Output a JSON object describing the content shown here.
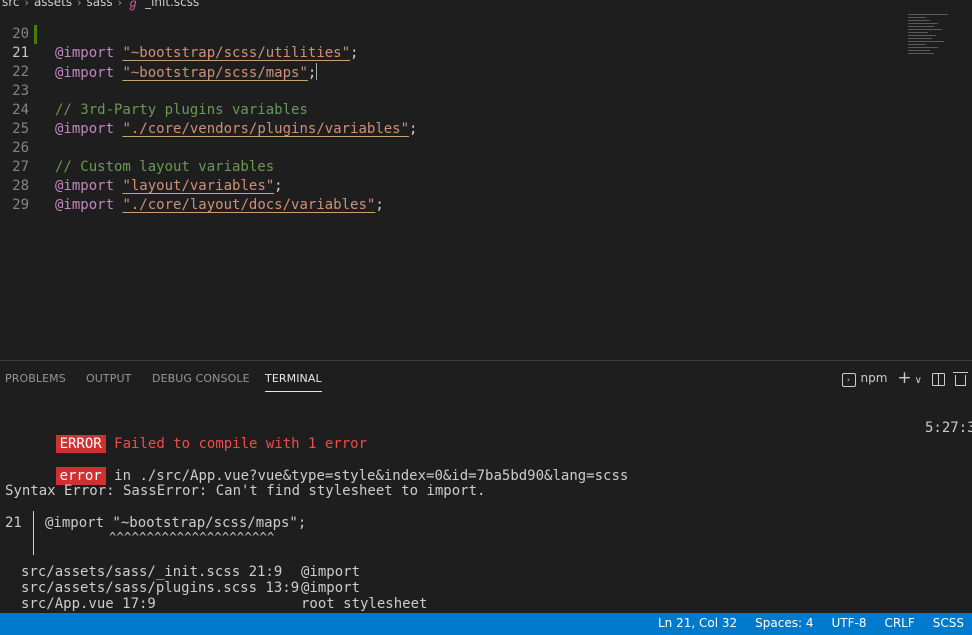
{
  "breadcrumb": [
    "src",
    "assets",
    "sass",
    "_init.scss"
  ],
  "editor": {
    "lines": [
      {
        "n": "20",
        "kw": "@import",
        "str": "\"~bootstrap/scss/utilities\"",
        "end": ";"
      },
      {
        "n": "21",
        "kw": "@import",
        "str": "\"~bootstrap/scss/maps\"",
        "end": ";"
      },
      {
        "n": "22"
      },
      {
        "n": "23",
        "comment": "// 3rd-Party plugins variables"
      },
      {
        "n": "24",
        "kw": "@import",
        "str": "\"./core/vendors/plugins/variables\"",
        "end": ";"
      },
      {
        "n": "25"
      },
      {
        "n": "26",
        "comment": "// Custom layout variables"
      },
      {
        "n": "27",
        "kw": "@import",
        "str": "\"layout/variables\"",
        "end": ";"
      },
      {
        "n": "28",
        "kw": "@import",
        "str": "\"./core/layout/docs/variables\"",
        "end": ";"
      },
      {
        "n": "29"
      }
    ]
  },
  "panel": {
    "tabs": [
      "PROBLEMS",
      "OUTPUT",
      "DEBUG CONSOLE",
      "TERMINAL"
    ],
    "terminal_name": "npm",
    "add_symbol": "+",
    "dropdown_symbol": "∨"
  },
  "terminal": {
    "error_badge": "ERROR",
    "error_msg": "Failed to compile with 1 error",
    "time": "5:27:3",
    "err_badge": "error",
    "err_location": " in ./src/App.vue?vue&type=style&index=0&id=7ba5bd90&lang=scss",
    "syntax_error": "Syntax Error: SassError: Can't find stylesheet to import.",
    "code_line_no": "21",
    "code_line": "@import \"~bootstrap/scss/maps\";",
    "carets": "^^^^^^^^^^^^^^^^^^^^^^",
    "stack": [
      {
        "file": "src/assets/sass/_init.scss 21:9",
        "what": "@import"
      },
      {
        "file": "src/assets/sass/plugins.scss 13:9",
        "what": "@import"
      },
      {
        "file": "src/App.vue 17:9",
        "what": "root stylesheet"
      }
    ]
  },
  "statusbar": {
    "position": "Ln 21, Col 32",
    "spaces": "Spaces: 4",
    "encoding": "UTF-8",
    "eol": "CRLF",
    "language": "SCSS"
  },
  "colors": {
    "accent": "#007acc",
    "error": "#cd3131",
    "keyword": "#c586c0",
    "string": "#ce9178",
    "comment": "#6a9955"
  }
}
